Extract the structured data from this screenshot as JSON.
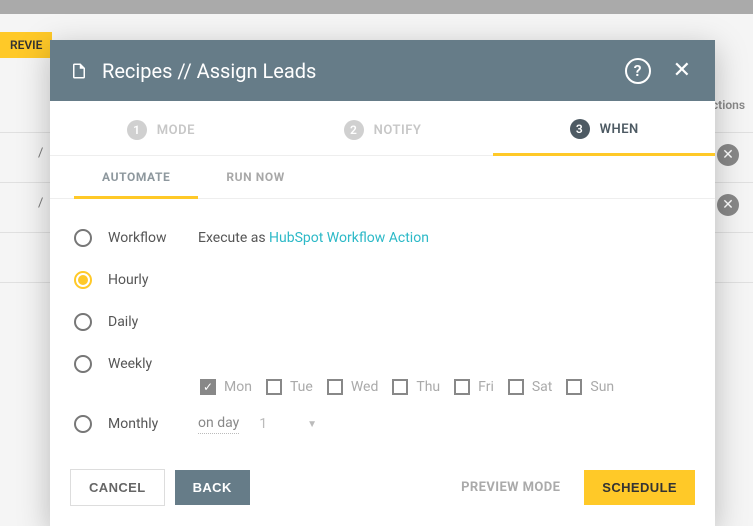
{
  "background": {
    "badge": "REVIE",
    "actions_label": "ctions",
    "slash": "/"
  },
  "modal": {
    "title": "Recipes // Assign Leads",
    "steps": [
      {
        "num": "1",
        "label": "MODE"
      },
      {
        "num": "2",
        "label": "NOTIFY"
      },
      {
        "num": "3",
        "label": "WHEN"
      }
    ],
    "active_step_index": 2,
    "subtabs": {
      "automate": "AUTOMATE",
      "run_now": "RUN NOW",
      "active": "automate"
    },
    "options": {
      "workflow": {
        "label": "Workflow",
        "detail_prefix": "Execute as ",
        "detail_link": "HubSpot Workflow Action"
      },
      "hourly": {
        "label": "Hourly"
      },
      "daily": {
        "label": "Daily"
      },
      "weekly": {
        "label": "Weekly",
        "days": [
          {
            "abbr": "Mon",
            "checked": true
          },
          {
            "abbr": "Tue",
            "checked": false
          },
          {
            "abbr": "Wed",
            "checked": false
          },
          {
            "abbr": "Thu",
            "checked": false
          },
          {
            "abbr": "Fri",
            "checked": false
          },
          {
            "abbr": "Sat",
            "checked": false
          },
          {
            "abbr": "Sun",
            "checked": false
          }
        ]
      },
      "monthly": {
        "label": "Monthly",
        "on_day_label": "on day",
        "day_value": "1"
      },
      "selected": "hourly"
    },
    "footer": {
      "cancel": "CANCEL",
      "back": "BACK",
      "preview": "PREVIEW MODE",
      "schedule": "SCHEDULE"
    }
  }
}
